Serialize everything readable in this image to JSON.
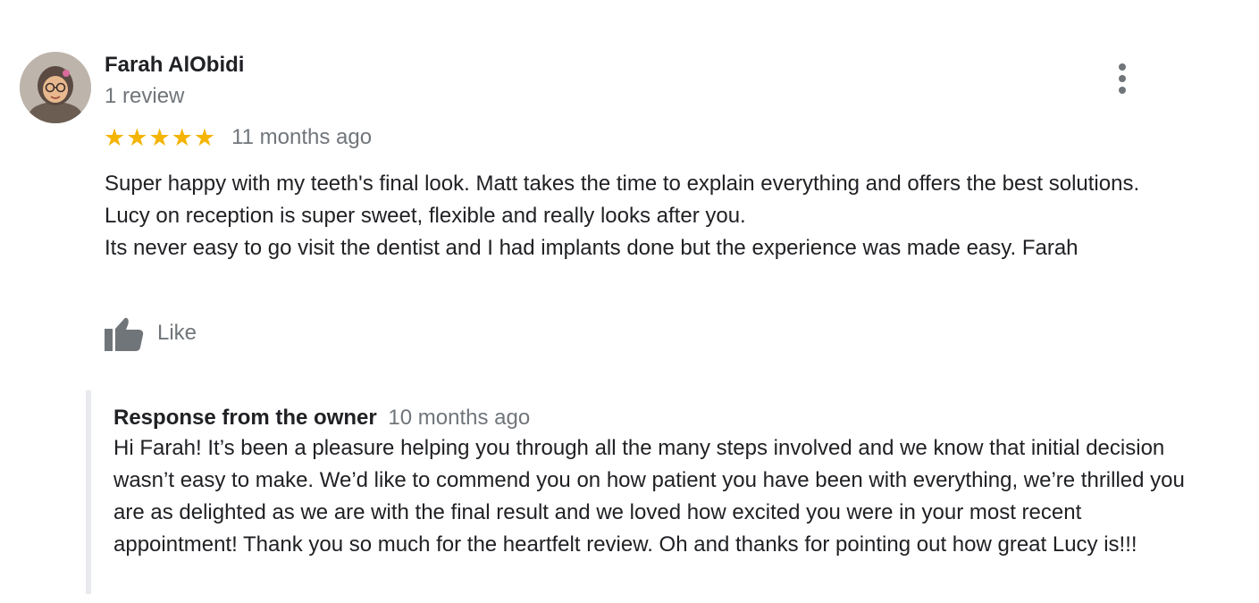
{
  "review": {
    "author": "Farah AlObidi",
    "review_count": "1 review",
    "rating": 5,
    "star_glyph": "★",
    "star_color": "#f4b400",
    "time_ago": "11 months ago",
    "lines": [
      "Super happy with my teeth's final look.  Matt takes the time to explain everything and offers the best solutions.",
      "Lucy on reception is super sweet, flexible and really looks after you.",
      "Its never easy to go visit the dentist and I had implants done but the experience was made easy.  Farah"
    ],
    "like_label": "Like",
    "like_icon": "thumbs-up-icon",
    "menu_icon": "more-vert-icon"
  },
  "response": {
    "title": "Response from the owner",
    "time_ago": "10 months ago",
    "body": "Hi Farah! It’s been a pleasure helping you through all the many steps involved and we know that initial decision wasn’t easy to make. We’d like to commend you on how patient you have been with everything, we’re thrilled you are as delighted as we are with the final result and we loved how excited you were in your most recent appointment! Thank you so much for the heartfelt review. Oh and thanks for pointing out how great Lucy is!!!"
  },
  "colors": {
    "primary_text": "#202124",
    "secondary_text": "#70757a",
    "response_border": "#e8eaed"
  }
}
